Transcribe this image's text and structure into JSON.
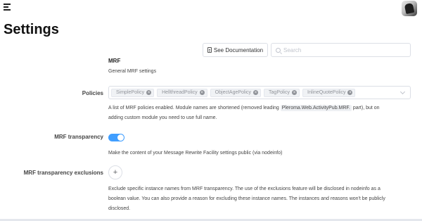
{
  "header": {
    "menu_icon": "hamburger-menu-icon",
    "avatar_icon": "user-avatar"
  },
  "page": {
    "title": "Settings"
  },
  "toolbar": {
    "documentation_label": "See Documentation",
    "search_placeholder": "Search"
  },
  "mrf": {
    "title": "MRF",
    "description": "General MRF settings",
    "policies": {
      "label": "Policies",
      "tags": [
        "SimplePolicy",
        "HellthreadPolicy",
        "ObjectAgePolicy",
        "TagPolicy",
        "InlineQuotePolicy"
      ],
      "help_before": "A list of MRF policies enabled. Module names are shortened (removed leading ",
      "help_code": "Pleroma.Web.ActivityPub.MRF.",
      "help_after": " part), but on",
      "help_line2": "adding custom module you need to use full name."
    },
    "transparency": {
      "label": "MRF transparency",
      "enabled": true,
      "help": "Make the content of your Message Rewrite Facility settings public (via nodeinfo)"
    },
    "transparency_exclusions": {
      "label": "MRF transparency exclusions",
      "add_icon": "plus-icon",
      "help_line1": "Exclude specific instance names from MRF transparency. The use of the exclusions feature will be disclosed in nodeinfo as a",
      "help_line2": "boolean value. You can also provide a reason for excluding these instance names. The instances and reasons won't be publicly",
      "help_line3": "disclosed."
    }
  }
}
